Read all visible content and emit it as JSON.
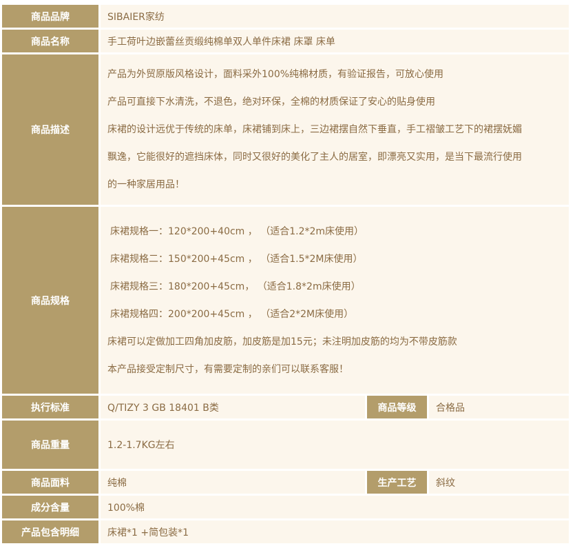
{
  "rows": {
    "brand": {
      "label": "商品品牌",
      "value": "SIBAIER家纺"
    },
    "name": {
      "label": "商品名称",
      "value": "手工荷叶边嵌蕾丝贡缎纯棉单双人单件床裙 床罩 床单"
    },
    "desc": {
      "label": "商品描述",
      "lines": [
        "产品为外贸原版风格设计，面料采外100%纯棉材质，有验证报告，可放心使用",
        "产品可直接下水清洗，不退色，绝对环保，全棉的材质保证了安心的贴身使用",
        "床裙的设计远优于传统的床单，床裙铺到床上，三边裙摆自然下垂直，手工褶皱工艺下的裙摆妩媚",
        "飘逸，它能很好的遮挡床体，同时又很好的美化了主人的居室，即漂亮又实用，是当下最流行使用",
        "的一种家居用品！"
      ]
    },
    "spec": {
      "label": "商品规格",
      "lines": [
        "床裙规格一：120*200+40cm ，  （适合1.2*2m床使用）",
        "床裙规格二：150*200+45cm ，  （适合1.5*2M床使用）",
        "床裙规格三：180*200+45cm，    （适合1.8*2m床使用）",
        "床裙规格四：200*200+45cm  ，  （适合2*2M床使用）",
        "床裙可以定做加工四角加皮筋，加皮筋是加15元；未注明加皮筋的均为不带皮筋款",
        "本产品接受定制尺寸，有需要定制的亲们可以联系客服！"
      ]
    },
    "standard": {
      "label": "执行标准",
      "value": "Q/TIZY 3 GB 18401 B类",
      "label2": "商品等级",
      "value2": "合格品"
    },
    "weight": {
      "label": "商品重量",
      "value": "1.2-1.7KG左右"
    },
    "fabric": {
      "label": "商品面料",
      "value": "纯棉",
      "label2": "生产工艺",
      "value2": "斜纹"
    },
    "content": {
      "label": "成分含量",
      "value": "100%棉"
    },
    "package": {
      "label": "产品包含明细",
      "value": "床裙*1 +简包装*1"
    }
  }
}
